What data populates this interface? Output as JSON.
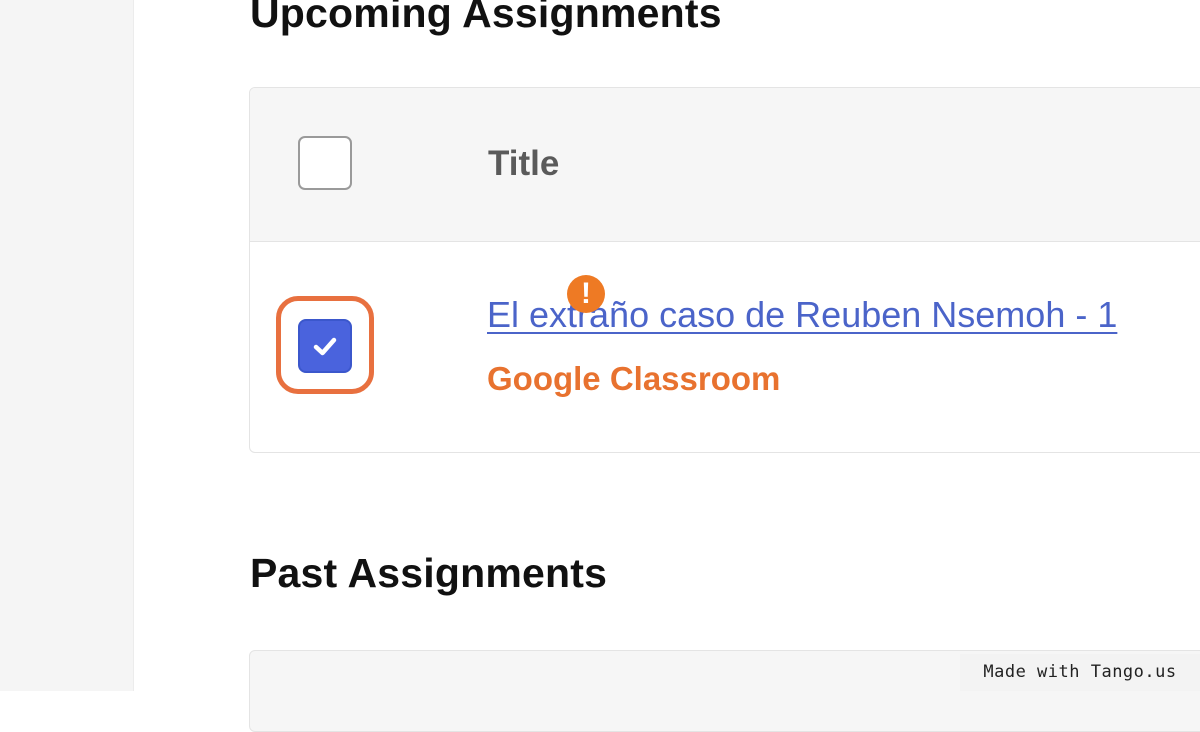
{
  "upcoming": {
    "heading": "Upcoming Assignments",
    "table": {
      "title_column": "Title",
      "select_all_checked": false,
      "rows": [
        {
          "title": "El extraño caso de Reuben Nsemoh - 1",
          "source": "Google Classroom",
          "selected": true,
          "alert_icon": "exclamation-circle"
        }
      ]
    }
  },
  "past": {
    "heading": "Past Assignments"
  },
  "colors": {
    "accent_blue": "#4a63dd",
    "link_blue": "#4b64c9",
    "warning_orange": "#e8722f",
    "highlight_orange": "#e8703f"
  },
  "watermark": "Made with Tango.us"
}
